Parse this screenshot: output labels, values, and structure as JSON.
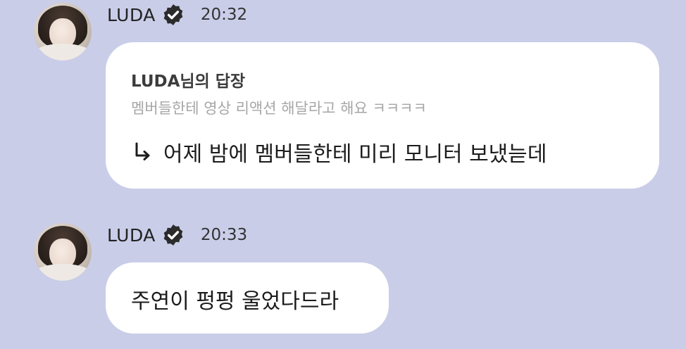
{
  "messages": [
    {
      "sender": "LUDA",
      "time": "20:32",
      "reply": {
        "title": "LUDA님의 답장",
        "quoted": "멤버들한테 영상 리액션 해달라고 해요 ㅋㅋㅋㅋ",
        "text": "어제 밤에 멤버들한테 미리 모니터 보냈늗데"
      }
    },
    {
      "sender": "LUDA",
      "time": "20:33",
      "text": "주연이 펑펑 울었다드라"
    }
  ],
  "icons": {
    "verified": "verified-badge-icon",
    "reply_arrow": "reply-arrow-icon"
  },
  "colors": {
    "background": "#c9cde8",
    "bubble": "#ffffff",
    "badge": "#2b2b2b"
  }
}
